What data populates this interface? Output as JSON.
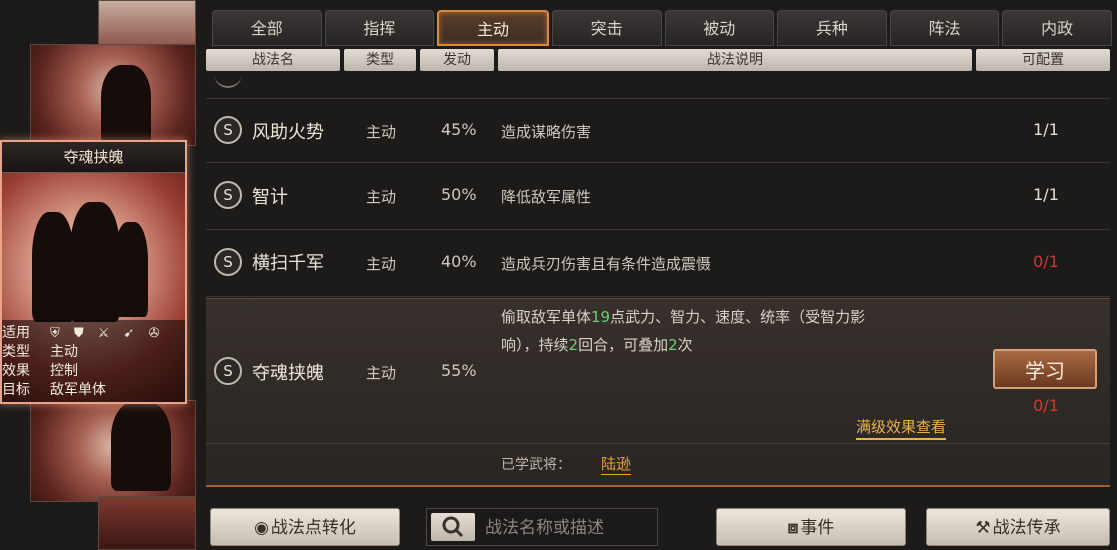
{
  "card": {
    "title": "夺魂挟魄",
    "rows": [
      {
        "key": "适用",
        "icons": "⛨ ⛊ ⚔ ➹ ✇"
      },
      {
        "key": "类型",
        "value": "主动"
      },
      {
        "key": "效果",
        "value": "控制"
      },
      {
        "key": "目标",
        "value": "敌军单体"
      }
    ]
  },
  "tabs": [
    "全部",
    "指挥",
    "主动",
    "突击",
    "被动",
    "兵种",
    "阵法",
    "内政"
  ],
  "active_tab": "主动",
  "columns": {
    "name": "战法名",
    "type": "类型",
    "trigger": "发动",
    "desc": "战法说明",
    "config": "可配置"
  },
  "skills": [
    {
      "badge": "S",
      "name": "风助火势",
      "type": "主动",
      "rate": "45%",
      "desc": "造成谋略伤害",
      "config": "1/1"
    },
    {
      "badge": "S",
      "name": "智计",
      "type": "主动",
      "rate": "50%",
      "desc": "降低敌军属性",
      "config": "1/1"
    },
    {
      "badge": "S",
      "name": "横扫千军",
      "type": "主动",
      "rate": "40%",
      "desc": "造成兵刃伤害且有条件造成震慑",
      "config": "0/1"
    }
  ],
  "expanded": {
    "badge": "S",
    "name": "夺魂挟魄",
    "type": "主动",
    "rate": "55%",
    "desc_parts": {
      "a": "偷取敌军单体",
      "n1": "19",
      "b": "点武力、智力、速度、统率（受智力影",
      "c": "响），持续",
      "n2": "2",
      "d": "回合，可叠加",
      "n3": "2",
      "e": "次"
    },
    "learn_label": "学习",
    "config": "0/1",
    "full_effect_label": "满级效果查看",
    "learned_label": "已学武将：",
    "learned_general": "陆逊"
  },
  "bottom": {
    "convert_label": "战法点转化",
    "search_placeholder": "战法名称或描述",
    "event_label": "事件",
    "inherit_label": "战法传承"
  }
}
